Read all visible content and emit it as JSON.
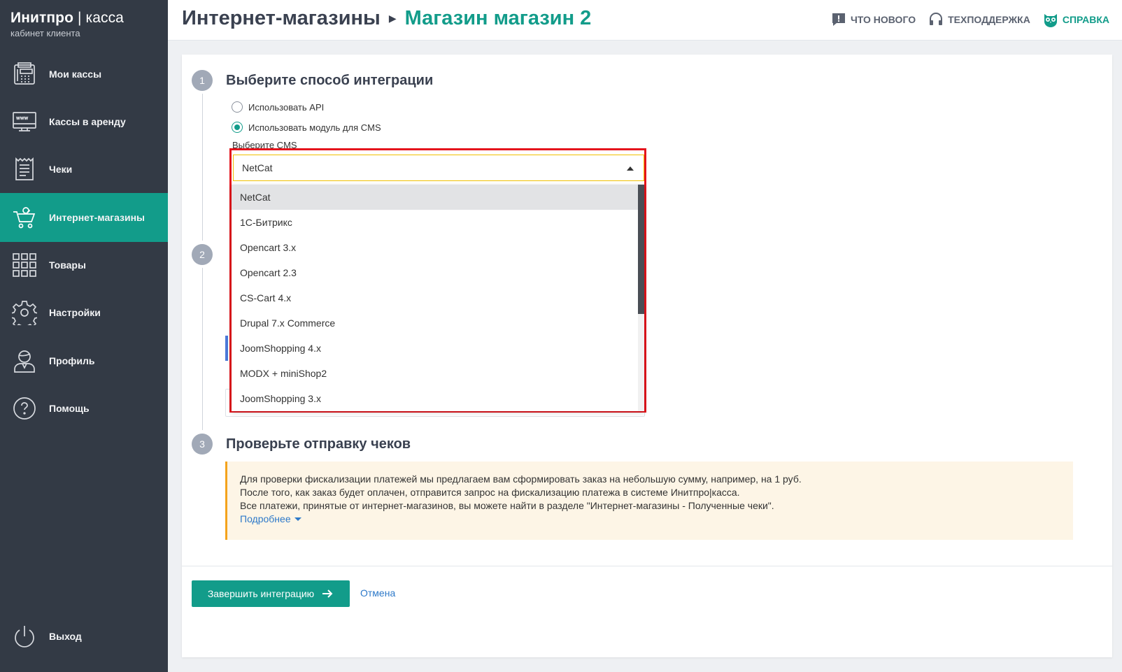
{
  "brand": {
    "title_bold": "Инитпро",
    "title_sep": " | ",
    "title_thin": "касса",
    "subtitle": "кабинет клиента"
  },
  "sidebar": {
    "items": [
      {
        "label": "Мои кассы",
        "icon": "cash-register-icon"
      },
      {
        "label": "Кассы в аренду",
        "icon": "www-monitor-icon"
      },
      {
        "label": "Чеки",
        "icon": "receipt-icon"
      },
      {
        "label": "Интернет-магазины",
        "icon": "shopping-cart-icon",
        "active": true
      },
      {
        "label": "Товары",
        "icon": "grid-icon"
      },
      {
        "label": "Настройки",
        "icon": "gear-icon"
      },
      {
        "label": "Профиль",
        "icon": "user-icon"
      },
      {
        "label": "Помощь",
        "icon": "question-icon"
      }
    ],
    "logout": {
      "label": "Выход",
      "icon": "power-icon"
    }
  },
  "header": {
    "crumb_parent": "Интернет-магазины",
    "crumb_current": "Магазин магазин 2",
    "links": {
      "whats_new": "ЧТО НОВОГО",
      "support": "ТЕХПОДДЕРЖКА",
      "help": "СПРАВКА"
    }
  },
  "steps": {
    "one": {
      "number": "1",
      "title": "Выберите способ интеграции"
    },
    "two": {
      "number": "2"
    },
    "three": {
      "number": "3",
      "title": "Проверьте отправку чеков"
    }
  },
  "integration": {
    "option_api": "Использовать API",
    "option_cms": "Использовать модуль для CMS",
    "selected_option": "cms",
    "cms_label": "Выберите CMS",
    "cms_selected": "NetCat",
    "cms_options": [
      "NetCat",
      "1С-Битрикс",
      "Opencart 3.x",
      "Opencart 2.3",
      "CS-Cart 4.x",
      "Drupal 7.x Commerce",
      "JoomShopping 4.x",
      "MODX + miniShop2",
      "JoomShopping 3.x"
    ]
  },
  "notice": {
    "line1": "Для проверки фискализации платежей мы предлагаем вам сформировать заказ на небольшую сумму, например, на 1 руб.",
    "line2": "После того, как заказ будет оплачен, отправится запрос на фискализацию платежа в системе Инитпро|касса.",
    "line3": "Все платежи, принятые от интернет-магазинов, вы можете найти в разделе \"Интернет-магазины - Полученные чеки\".",
    "more": "Подробнее"
  },
  "actions": {
    "finish": "Завершить интеграцию",
    "cancel": "Отмена"
  },
  "colors": {
    "sidebar": "#333a45",
    "accent": "#129c8a",
    "highlight": "#e5141c",
    "link": "#2d79c9",
    "notice_bg": "#fdf5e6",
    "notice_border": "#f4a31c"
  }
}
